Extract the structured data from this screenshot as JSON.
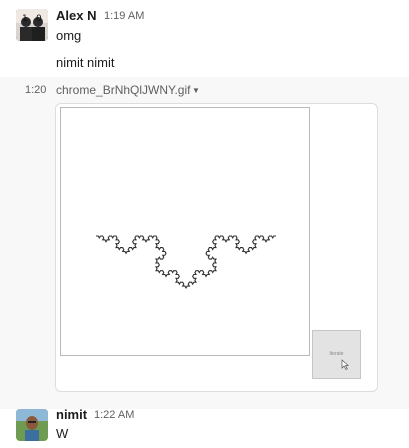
{
  "messages": [
    {
      "author": "Alex N",
      "time": "1:19 AM",
      "lines": [
        "omg",
        "nimit nimit"
      ]
    },
    {
      "author": "nimit",
      "time": "1:22 AM",
      "lines": [
        "W"
      ]
    }
  ],
  "attachment_row": {
    "time": "1:20",
    "filename": "chrome_BrNhQlJWNY.gif",
    "caret_icon": "caret-down-icon",
    "button_label": "Iterate"
  },
  "colors": {
    "name": "#1d1c1d",
    "meta": "#616061",
    "hover_row": "#f8f8f8",
    "curve": "#333333"
  }
}
